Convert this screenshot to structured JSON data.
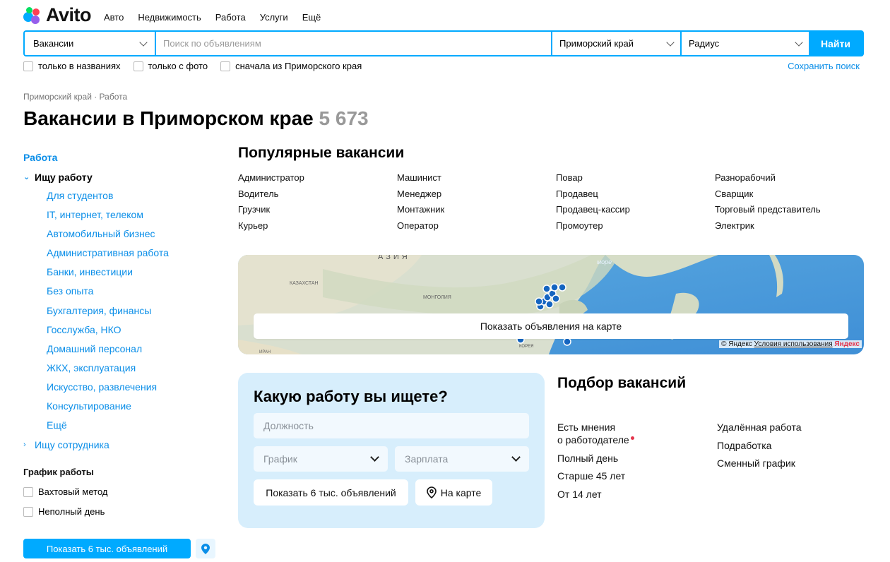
{
  "header": {
    "logo_text": "Avito",
    "nav": [
      "Авто",
      "Недвижимость",
      "Работа",
      "Услуги",
      "Ещё"
    ]
  },
  "search": {
    "category": "Вакансии",
    "placeholder": "Поиск по объявлениям",
    "region": "Приморский край",
    "radius": "Радиус",
    "submit": "Найти",
    "filters": [
      "только в названиях",
      "только с фото",
      "сначала из Приморского края"
    ],
    "save_label": "Сохранить поиск"
  },
  "breadcrumb": "Приморский край · Работа",
  "page": {
    "title": "Вакансии в Приморском крае",
    "count": "5 673"
  },
  "sidebar": {
    "heading": "Работа",
    "expanded": "Ищу работу",
    "items": [
      "Для студентов",
      "IT, интернет, телеком",
      "Автомобильный бизнес",
      "Административная работа",
      "Банки, инвестиции",
      "Без опыта",
      "Бухгалтерия, финансы",
      "Госслужба, НКО",
      "Домашний персонал",
      "ЖКХ, эксплуатация",
      "Искусство, развлечения",
      "Консультирование",
      "Ещё"
    ],
    "collapsed": "Ищу сотрудника",
    "schedule_heading": "График работы",
    "schedule_options": [
      "Вахтовый метод",
      "Неполный день"
    ],
    "show_button": "Показать 6 тыс. объявлений"
  },
  "popular": {
    "title": "Популярные вакансии",
    "items": [
      "Администратор",
      "Машинист",
      "Повар",
      "Разнорабочий",
      "Водитель",
      "Менеджер",
      "Продавец",
      "Сварщик",
      "Грузчик",
      "Монтажник",
      "Продавец-кассир",
      "Торговый представитель",
      "Курьер",
      "Оператор",
      "Промоутер",
      "Электрик"
    ]
  },
  "map": {
    "button": "Показать объявления на карте",
    "labels": {
      "asia": "АЗИЯ",
      "kazakhstan": "КАЗАХСТАН",
      "mongolia": "МОНГОЛИЯ",
      "sea": "море",
      "korea": "КОРЕЯ",
      "iran": "ИРАН"
    },
    "copyright_prefix": "© Яндекс",
    "terms": "Условия использования",
    "brand": "Яндекс"
  },
  "job_search": {
    "title": "Какую работу вы ищете?",
    "position_placeholder": "Должность",
    "schedule_placeholder": "График",
    "salary_placeholder": "Зарплата",
    "show_button": "Показать 6 тыс. объявлений",
    "map_button": "На карте"
  },
  "picker": {
    "title": "Подбор вакансий",
    "col1": [
      "Есть мнения",
      "о работодателе",
      "Полный день",
      "Старше 45 лет",
      "От 14 лет"
    ],
    "col2": [
      "Удалённая работа",
      "Подработка",
      "Сменный график"
    ]
  },
  "colors": {
    "accent": "#00aaff",
    "link": "#0a8ee8",
    "panel": "#d7eefc"
  },
  "icons": [
    "avito-logo-dots",
    "chevron-down-icon",
    "map-pin-icon"
  ]
}
